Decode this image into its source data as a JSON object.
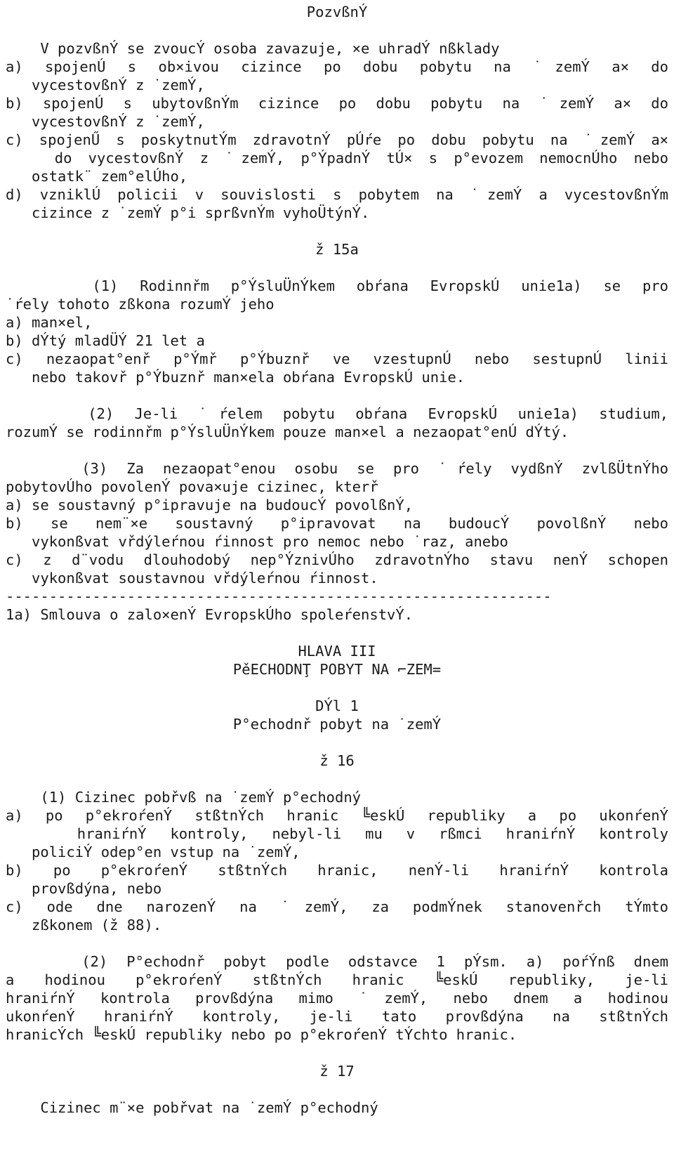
{
  "document": {
    "title": "PozvßnÝ",
    "sections": [
      {
        "id": "pozvani-intro",
        "lines": [
          {
            "text": "    V pozvßnÝ se zvoucÝ osoba zavazuje, ×e uhradÝ nßklady",
            "style": "plain"
          },
          {
            "text": "a) spojenÚ s ob×ivou cizince po dobu pobytu na ˙zemÝ a× do",
            "style": "justify"
          },
          {
            "text": "   vycestovßnÝ z ˙zemÝ,",
            "style": "plain"
          },
          {
            "text": "b) spojenÚ s ubytovßnÝm cizince po dobu pobytu na ˙zemÝ a× do",
            "style": "justify"
          },
          {
            "text": "   vycestovßnÝ z ˙zemÝ,",
            "style": "plain"
          },
          {
            "text": "c) spojenŰ s poskytnutÝm zdravotnÝ pÚŕe po dobu pobytu na ˙zemÝ a×",
            "style": "justify"
          },
          {
            "text": "   do vycestovßnÝ z ˙zemÝ, p°ÝpadnÝ tÚ× s p°evozem nemocnÚho nebo",
            "style": "justify"
          },
          {
            "text": "   ostatk¨ zem°elÚho,",
            "style": "plain"
          },
          {
            "text": "d) vzniklÚ policii v souvislosti s pobytem na ˙zemÝ a vycestovßnÝm",
            "style": "justify"
          },
          {
            "text": "   cizince z ˙zemÝ p°i sprßvnÝm vyhoÜtýnÝ.",
            "style": "plain"
          }
        ]
      },
      {
        "id": "paragraph-15a-heading",
        "lines": [
          {
            "text": "ž 15a",
            "style": "center"
          }
        ]
      },
      {
        "id": "paragraph-15a-body",
        "lines": [
          {
            "text": "    (1) Rodinnřm p°ÝsluÜnÝkem obŕana EvropskÚ unie1a) se pro",
            "style": "justify"
          },
          {
            "text": "˙ŕely tohoto zßkona rozumÝ jeho",
            "style": "plain"
          },
          {
            "text": "a) man×el,",
            "style": "plain"
          },
          {
            "text": "b) dÝtý mladÜÝ 21 let a",
            "style": "plain"
          },
          {
            "text": "c) nezaopat°enř p°Ýmř p°Ýbuznř ve vzestupnÚ nebo sestupnÚ linii",
            "style": "justify"
          },
          {
            "text": "   nebo takovř p°Ýbuznř man×ela obŕana EvropskÚ unie.",
            "style": "plain"
          },
          {
            "text": "",
            "style": "blank"
          },
          {
            "text": "    (2) Je-li ˙ŕelem pobytu obŕana EvropskÚ unie1a) studium,",
            "style": "justify"
          },
          {
            "text": "rozumÝ se rodinnřm p°ÝsluÜnÝkem pouze man×el a nezaopat°enÚ dÝtý.",
            "style": "plain"
          },
          {
            "text": "",
            "style": "blank"
          },
          {
            "text": "    (3) Za nezaopat°enou osobu se pro ˙ŕely vydßnÝ zvlßÜtnÝho",
            "style": "justify"
          },
          {
            "text": "pobytovÚho povolenÝ pova×uje cizinec, kterř",
            "style": "plain"
          },
          {
            "text": "a) se soustavný p°ipravuje na budoucÝ povolßnÝ,",
            "style": "plain"
          },
          {
            "text": "b) se nem¨×e soustavný p°ipravovat na budoucÝ povolßnÝ nebo",
            "style": "justify"
          },
          {
            "text": "   vykonßvat vřdýleŕnou ŕinnost pro nemoc nebo ˙raz, anebo",
            "style": "plain"
          },
          {
            "text": "c) z d¨vodu dlouhodobý nep°ÝznivÚho zdravotnÝho stavu nenÝ schopen",
            "style": "justify"
          },
          {
            "text": "   vykonßvat soustavnou vřdýleŕnou ŕinnost.",
            "style": "plain"
          }
        ]
      },
      {
        "id": "footnote",
        "rule": "---------------------------------------------------------------",
        "lines": [
          {
            "text": "1a) Smlouva o zalo×enÝ EvropskÚho spoleŕenstvÝ.",
            "style": "plain"
          }
        ]
      },
      {
        "id": "hlava-iii",
        "lines": [
          {
            "text": "HLAVA III",
            "style": "center"
          },
          {
            "text": "PěECHODNŢ POBYT NA ⌐ZEM=",
            "style": "center"
          }
        ]
      },
      {
        "id": "dil-1",
        "lines": [
          {
            "text": "DÝl 1",
            "style": "center"
          },
          {
            "text": "P°echodnř pobyt na ˙zemÝ",
            "style": "center"
          }
        ]
      },
      {
        "id": "paragraph-16-heading",
        "lines": [
          {
            "text": "ž 16",
            "style": "center"
          }
        ]
      },
      {
        "id": "paragraph-16-body",
        "lines": [
          {
            "text": "    (1) Cizinec pobřvß na ˙zemÝ p°echodný",
            "style": "plain"
          },
          {
            "text": "a) po p°ekroŕenÝ stßtnÝch hranic ╚eskÚ republiky a po ukonŕenÝ",
            "style": "justify"
          },
          {
            "text": "   hraniŕnÝ kontroly, nebyl-li mu v rßmci hraniŕnÝ kontroly",
            "style": "justify"
          },
          {
            "text": "   policiÝ odep°en vstup na ˙zemÝ,",
            "style": "plain"
          },
          {
            "text": "b) po p°ekroŕenÝ stßtnÝch hranic, nenÝ-li hraniŕnÝ kontrola",
            "style": "justify"
          },
          {
            "text": "   provßdýna, nebo",
            "style": "plain"
          },
          {
            "text": "c) ode dne narozenÝ na ˙zemÝ, za podmÝnek stanovenřch tÝmto",
            "style": "justify"
          },
          {
            "text": "   zßkonem (ž 88).",
            "style": "plain"
          },
          {
            "text": "",
            "style": "blank"
          },
          {
            "text": "    (2) P°echodnř pobyt podle odstavce 1 pÝsm. a) poŕÝnß dnem",
            "style": "justify"
          },
          {
            "text": "a hodinou p°ekroŕenÝ stßtnÝch hranic ╚eskÚ republiky, je-li",
            "style": "justify"
          },
          {
            "text": "hraniŕnÝ kontrola provßdýna mimo ˙zemÝ, nebo dnem a hodinou",
            "style": "justify"
          },
          {
            "text": "ukonŕenÝ hraniŕnÝ kontroly, je-li tato provßdýna na stßtnÝch",
            "style": "justify"
          },
          {
            "text": "hranicÝch ╚eskÚ republiky nebo po p°ekroŕenÝ tÝchto hranic.",
            "style": "plain"
          }
        ]
      },
      {
        "id": "paragraph-17-heading",
        "lines": [
          {
            "text": "ž 17",
            "style": "center"
          }
        ]
      },
      {
        "id": "paragraph-17-body",
        "lines": [
          {
            "text": "    Cizinec m¨×e pobřvat na ˙zemÝ p°echodný",
            "style": "plain"
          }
        ]
      }
    ]
  }
}
